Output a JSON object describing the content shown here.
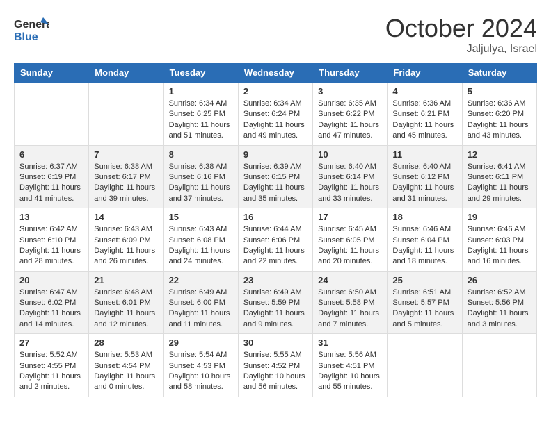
{
  "header": {
    "logo_line1": "General",
    "logo_line2": "Blue",
    "month": "October 2024",
    "location": "Jaljulya, Israel"
  },
  "weekdays": [
    "Sunday",
    "Monday",
    "Tuesday",
    "Wednesday",
    "Thursday",
    "Friday",
    "Saturday"
  ],
  "weeks": [
    [
      {
        "day": "",
        "sunrise": "",
        "sunset": "",
        "daylight": ""
      },
      {
        "day": "",
        "sunrise": "",
        "sunset": "",
        "daylight": ""
      },
      {
        "day": "1",
        "sunrise": "Sunrise: 6:34 AM",
        "sunset": "Sunset: 6:25 PM",
        "daylight": "Daylight: 11 hours and 51 minutes."
      },
      {
        "day": "2",
        "sunrise": "Sunrise: 6:34 AM",
        "sunset": "Sunset: 6:24 PM",
        "daylight": "Daylight: 11 hours and 49 minutes."
      },
      {
        "day": "3",
        "sunrise": "Sunrise: 6:35 AM",
        "sunset": "Sunset: 6:22 PM",
        "daylight": "Daylight: 11 hours and 47 minutes."
      },
      {
        "day": "4",
        "sunrise": "Sunrise: 6:36 AM",
        "sunset": "Sunset: 6:21 PM",
        "daylight": "Daylight: 11 hours and 45 minutes."
      },
      {
        "day": "5",
        "sunrise": "Sunrise: 6:36 AM",
        "sunset": "Sunset: 6:20 PM",
        "daylight": "Daylight: 11 hours and 43 minutes."
      }
    ],
    [
      {
        "day": "6",
        "sunrise": "Sunrise: 6:37 AM",
        "sunset": "Sunset: 6:19 PM",
        "daylight": "Daylight: 11 hours and 41 minutes."
      },
      {
        "day": "7",
        "sunrise": "Sunrise: 6:38 AM",
        "sunset": "Sunset: 6:17 PM",
        "daylight": "Daylight: 11 hours and 39 minutes."
      },
      {
        "day": "8",
        "sunrise": "Sunrise: 6:38 AM",
        "sunset": "Sunset: 6:16 PM",
        "daylight": "Daylight: 11 hours and 37 minutes."
      },
      {
        "day": "9",
        "sunrise": "Sunrise: 6:39 AM",
        "sunset": "Sunset: 6:15 PM",
        "daylight": "Daylight: 11 hours and 35 minutes."
      },
      {
        "day": "10",
        "sunrise": "Sunrise: 6:40 AM",
        "sunset": "Sunset: 6:14 PM",
        "daylight": "Daylight: 11 hours and 33 minutes."
      },
      {
        "day": "11",
        "sunrise": "Sunrise: 6:40 AM",
        "sunset": "Sunset: 6:12 PM",
        "daylight": "Daylight: 11 hours and 31 minutes."
      },
      {
        "day": "12",
        "sunrise": "Sunrise: 6:41 AM",
        "sunset": "Sunset: 6:11 PM",
        "daylight": "Daylight: 11 hours and 29 minutes."
      }
    ],
    [
      {
        "day": "13",
        "sunrise": "Sunrise: 6:42 AM",
        "sunset": "Sunset: 6:10 PM",
        "daylight": "Daylight: 11 hours and 28 minutes."
      },
      {
        "day": "14",
        "sunrise": "Sunrise: 6:43 AM",
        "sunset": "Sunset: 6:09 PM",
        "daylight": "Daylight: 11 hours and 26 minutes."
      },
      {
        "day": "15",
        "sunrise": "Sunrise: 6:43 AM",
        "sunset": "Sunset: 6:08 PM",
        "daylight": "Daylight: 11 hours and 24 minutes."
      },
      {
        "day": "16",
        "sunrise": "Sunrise: 6:44 AM",
        "sunset": "Sunset: 6:06 PM",
        "daylight": "Daylight: 11 hours and 22 minutes."
      },
      {
        "day": "17",
        "sunrise": "Sunrise: 6:45 AM",
        "sunset": "Sunset: 6:05 PM",
        "daylight": "Daylight: 11 hours and 20 minutes."
      },
      {
        "day": "18",
        "sunrise": "Sunrise: 6:46 AM",
        "sunset": "Sunset: 6:04 PM",
        "daylight": "Daylight: 11 hours and 18 minutes."
      },
      {
        "day": "19",
        "sunrise": "Sunrise: 6:46 AM",
        "sunset": "Sunset: 6:03 PM",
        "daylight": "Daylight: 11 hours and 16 minutes."
      }
    ],
    [
      {
        "day": "20",
        "sunrise": "Sunrise: 6:47 AM",
        "sunset": "Sunset: 6:02 PM",
        "daylight": "Daylight: 11 hours and 14 minutes."
      },
      {
        "day": "21",
        "sunrise": "Sunrise: 6:48 AM",
        "sunset": "Sunset: 6:01 PM",
        "daylight": "Daylight: 11 hours and 12 minutes."
      },
      {
        "day": "22",
        "sunrise": "Sunrise: 6:49 AM",
        "sunset": "Sunset: 6:00 PM",
        "daylight": "Daylight: 11 hours and 11 minutes."
      },
      {
        "day": "23",
        "sunrise": "Sunrise: 6:49 AM",
        "sunset": "Sunset: 5:59 PM",
        "daylight": "Daylight: 11 hours and 9 minutes."
      },
      {
        "day": "24",
        "sunrise": "Sunrise: 6:50 AM",
        "sunset": "Sunset: 5:58 PM",
        "daylight": "Daylight: 11 hours and 7 minutes."
      },
      {
        "day": "25",
        "sunrise": "Sunrise: 6:51 AM",
        "sunset": "Sunset: 5:57 PM",
        "daylight": "Daylight: 11 hours and 5 minutes."
      },
      {
        "day": "26",
        "sunrise": "Sunrise: 6:52 AM",
        "sunset": "Sunset: 5:56 PM",
        "daylight": "Daylight: 11 hours and 3 minutes."
      }
    ],
    [
      {
        "day": "27",
        "sunrise": "Sunrise: 5:52 AM",
        "sunset": "Sunset: 4:55 PM",
        "daylight": "Daylight: 11 hours and 2 minutes."
      },
      {
        "day": "28",
        "sunrise": "Sunrise: 5:53 AM",
        "sunset": "Sunset: 4:54 PM",
        "daylight": "Daylight: 11 hours and 0 minutes."
      },
      {
        "day": "29",
        "sunrise": "Sunrise: 5:54 AM",
        "sunset": "Sunset: 4:53 PM",
        "daylight": "Daylight: 10 hours and 58 minutes."
      },
      {
        "day": "30",
        "sunrise": "Sunrise: 5:55 AM",
        "sunset": "Sunset: 4:52 PM",
        "daylight": "Daylight: 10 hours and 56 minutes."
      },
      {
        "day": "31",
        "sunrise": "Sunrise: 5:56 AM",
        "sunset": "Sunset: 4:51 PM",
        "daylight": "Daylight: 10 hours and 55 minutes."
      },
      {
        "day": "",
        "sunrise": "",
        "sunset": "",
        "daylight": ""
      },
      {
        "day": "",
        "sunrise": "",
        "sunset": "",
        "daylight": ""
      }
    ]
  ]
}
